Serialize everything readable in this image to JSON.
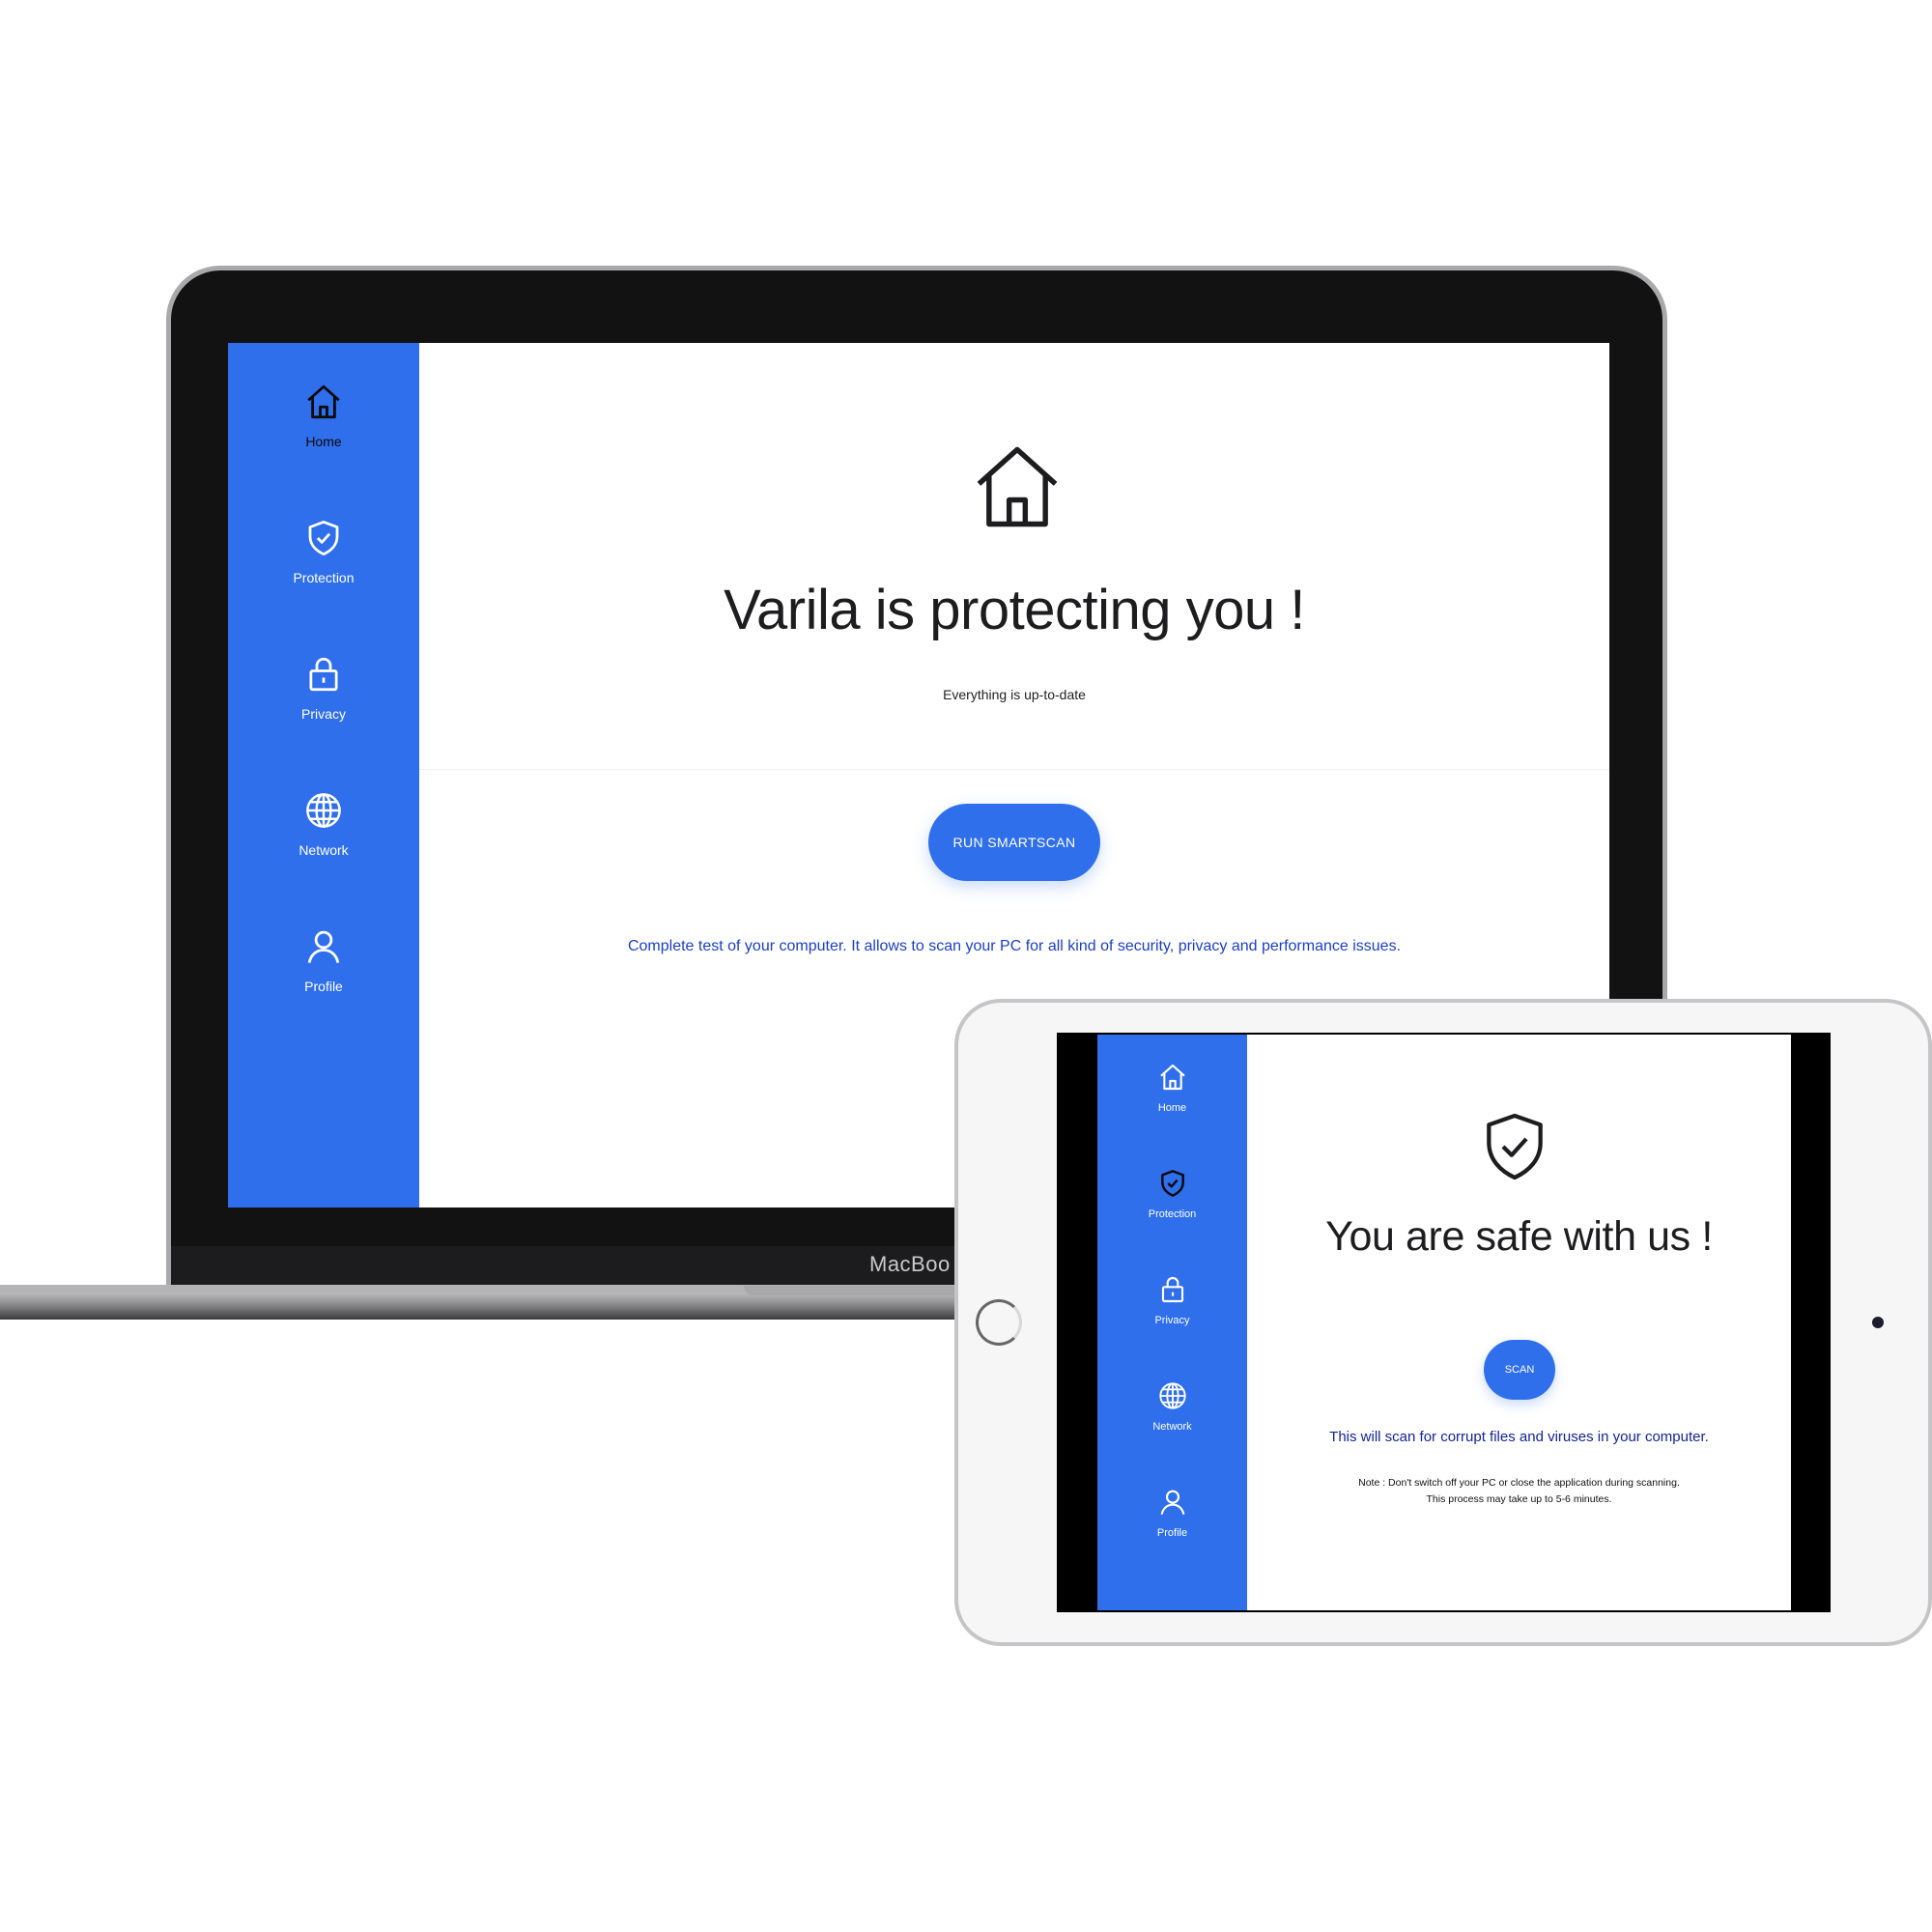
{
  "laptop": {
    "brand": "MacBoo",
    "nav": [
      {
        "label": "Home",
        "icon": "home-icon",
        "active": true
      },
      {
        "label": "Protection",
        "icon": "shield-check-icon"
      },
      {
        "label": "Privacy",
        "icon": "lock-icon"
      },
      {
        "label": "Network",
        "icon": "globe-icon"
      },
      {
        "label": "Profile",
        "icon": "user-icon"
      }
    ],
    "main": {
      "hero_icon": "home-icon",
      "title": "Varila is protecting you !",
      "subtitle": "Everything is up-to-date",
      "button_label": "RUN SMARTSCAN",
      "description": "Complete test of your computer. It allows to scan your PC for all kind of security, privacy and performance issues."
    }
  },
  "tablet": {
    "nav": [
      {
        "label": "Home",
        "icon": "home-icon"
      },
      {
        "label": "Protection",
        "icon": "shield-check-icon",
        "active": true
      },
      {
        "label": "Privacy",
        "icon": "lock-icon"
      },
      {
        "label": "Network",
        "icon": "globe-icon"
      },
      {
        "label": "Profile",
        "icon": "user-icon"
      }
    ],
    "main": {
      "hero_icon": "shield-check-icon",
      "title": "You are safe with us !",
      "button_label": "SCAN",
      "description": "This will scan for corrupt files and viruses in your computer.",
      "note_line1": "Note : Don't switch off your PC or close the application during scanning.",
      "note_line2": "This process may take up to 5-6 minutes."
    }
  },
  "colors": {
    "accent": "#2f6fec",
    "description_text": "#1b3fc4",
    "sidebar_text": "#ffffff"
  }
}
